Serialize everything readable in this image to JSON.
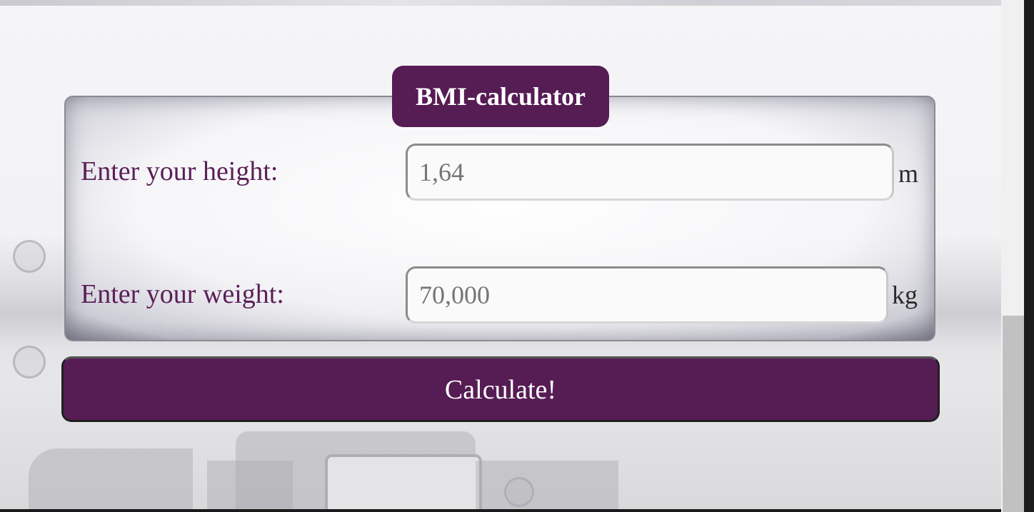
{
  "form": {
    "legend": "BMI-calculator",
    "height": {
      "label": "Enter your height:",
      "placeholder": "1,64",
      "unit": "m"
    },
    "weight": {
      "label": "Enter your weight:",
      "placeholder": "70,000",
      "unit": "kg"
    },
    "submit_label": "Calculate!"
  },
  "colors": {
    "accent": "#561c54",
    "label_text": "#5a1f57",
    "button_text": "#ffffff",
    "page_background": "#f4f4f6"
  }
}
